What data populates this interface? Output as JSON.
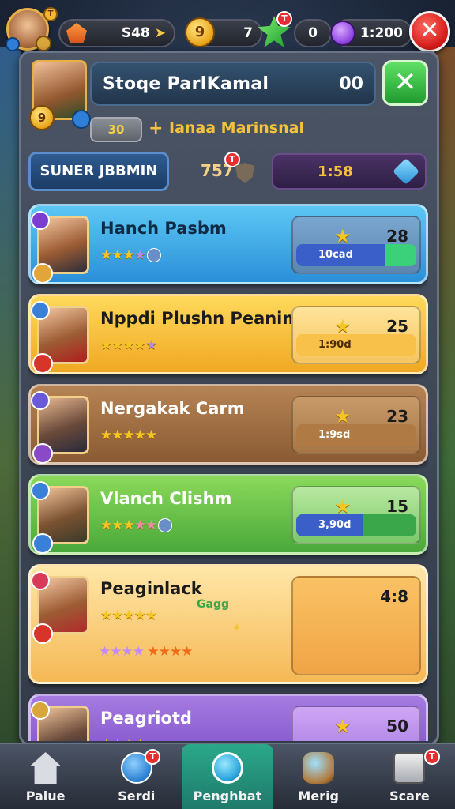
{
  "topbar": {
    "resource1": {
      "value": "S48"
    },
    "resource2": {
      "coin_glyph": "9",
      "value": "7"
    },
    "resource3": {
      "notif": "T",
      "value": "0"
    },
    "resource4": {
      "value": "1:200"
    },
    "avatar_badge": "T"
  },
  "profile": {
    "name": "Stoqe ParlKamal",
    "score": "00",
    "level_badge": "9",
    "xp_value": "30",
    "xp_plus": "+",
    "xp_label": "Ianaa Marinsnal"
  },
  "tabs": {
    "primary_label": "SUNER JBBMIN",
    "count": "757",
    "count_notif": "T",
    "purple_value": "1:58"
  },
  "cards": [
    {
      "title": "Hanch Pasbm",
      "stars": "★★★",
      "dim": "★",
      "score": "28",
      "bar_label": "10cad",
      "progress": 0.74
    },
    {
      "title": "Nppdi Plushn Peanimai",
      "stars": "★★★★",
      "dim": "★",
      "score": "25",
      "bar_label": "1:90d",
      "progress": 1.0
    },
    {
      "title": "Nergakak Carm",
      "stars": "★★★★★",
      "dim": "",
      "score": "23",
      "bar_label": "1:9sd",
      "progress": 1.0
    },
    {
      "title": "Vlanch Clishm",
      "stars": "★★★",
      "dim": "★★",
      "score": "15",
      "bar_label": "3,90d",
      "progress": 0.55
    },
    {
      "title": "Peaginlack",
      "stars": "★★★★★",
      "dim": "",
      "score": "4:8",
      "bar_label": "",
      "progress": 0,
      "extra": "Gagg",
      "row2_a": "★★★★",
      "row2_b": "★★★★"
    },
    {
      "title": "Peagriotd",
      "stars": "★★★★",
      "dim": "",
      "score": "50",
      "bar_label": "",
      "progress": 0
    }
  ],
  "nav": [
    {
      "label": "Palue",
      "icon": "home-icon"
    },
    {
      "label": "Serdi",
      "icon": "shield-icon",
      "notif": "T"
    },
    {
      "label": "Penghbat",
      "icon": "bubble-icon",
      "active": true
    },
    {
      "label": "Merig",
      "icon": "lantern-icon"
    },
    {
      "label": "Scare",
      "icon": "book-icon",
      "notif": "T"
    }
  ],
  "colors": {
    "accent": "#2aa889",
    "close": "#d11818",
    "confirm": "#1f9a2e",
    "gold": "#f3c623"
  }
}
